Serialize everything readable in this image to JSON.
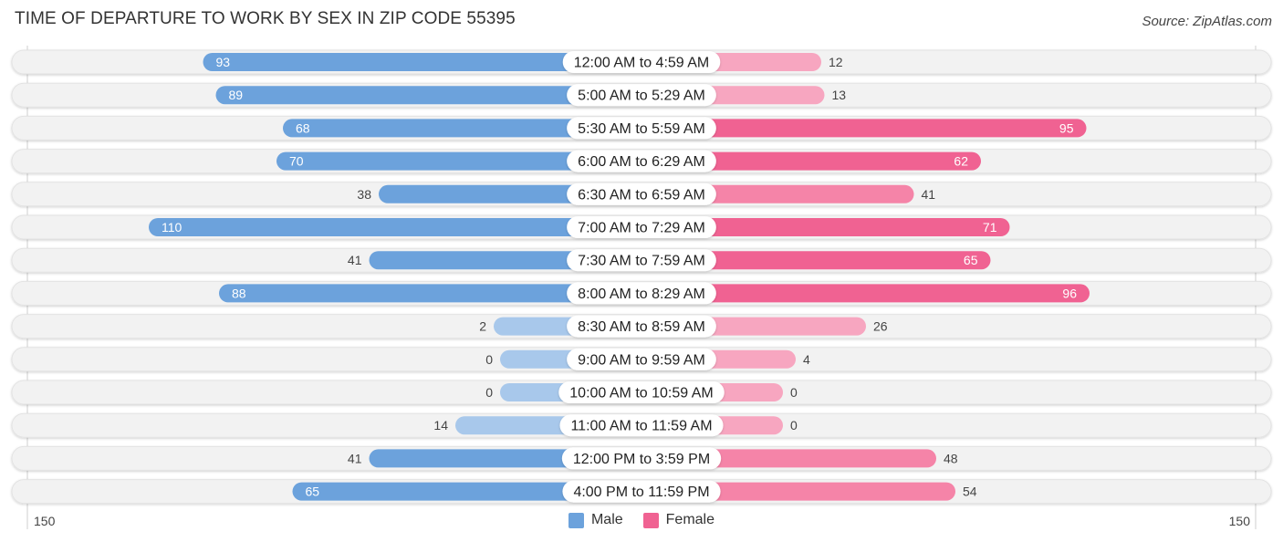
{
  "title": "TIME OF DEPARTURE TO WORK BY SEX IN ZIP CODE 55395",
  "source": "Source: ZipAtlas.com",
  "colors": {
    "male": "#6ca2dc",
    "male_light": "#a8c8eb",
    "female": "#f06292",
    "female_light": "#f7a6c0",
    "track": "#f2f2f2"
  },
  "legend": {
    "male": "Male",
    "female": "Female"
  },
  "axis": {
    "left_label": "150",
    "right_label": "150"
  },
  "chart_data": {
    "type": "bar",
    "orientation": "horizontal-diverging",
    "title": "TIME OF DEPARTURE TO WORK BY SEX IN ZIP CODE 55395",
    "categories": [
      "12:00 AM to 4:59 AM",
      "5:00 AM to 5:29 AM",
      "5:30 AM to 5:59 AM",
      "6:00 AM to 6:29 AM",
      "6:30 AM to 6:59 AM",
      "7:00 AM to 7:29 AM",
      "7:30 AM to 7:59 AM",
      "8:00 AM to 8:29 AM",
      "8:30 AM to 8:59 AM",
      "9:00 AM to 9:59 AM",
      "10:00 AM to 10:59 AM",
      "11:00 AM to 11:59 AM",
      "12:00 PM to 3:59 PM",
      "4:00 PM to 11:59 PM"
    ],
    "series": [
      {
        "name": "Male",
        "values": [
          93,
          89,
          68,
          70,
          38,
          110,
          41,
          88,
          2,
          0,
          0,
          14,
          41,
          65
        ]
      },
      {
        "name": "Female",
        "values": [
          12,
          13,
          95,
          62,
          41,
          71,
          65,
          96,
          26,
          4,
          0,
          0,
          48,
          54
        ]
      }
    ],
    "xlim": [
      -150,
      150
    ],
    "tick_labels": [
      "150",
      "150"
    ],
    "legend_position": "bottom-center",
    "grid": false
  }
}
